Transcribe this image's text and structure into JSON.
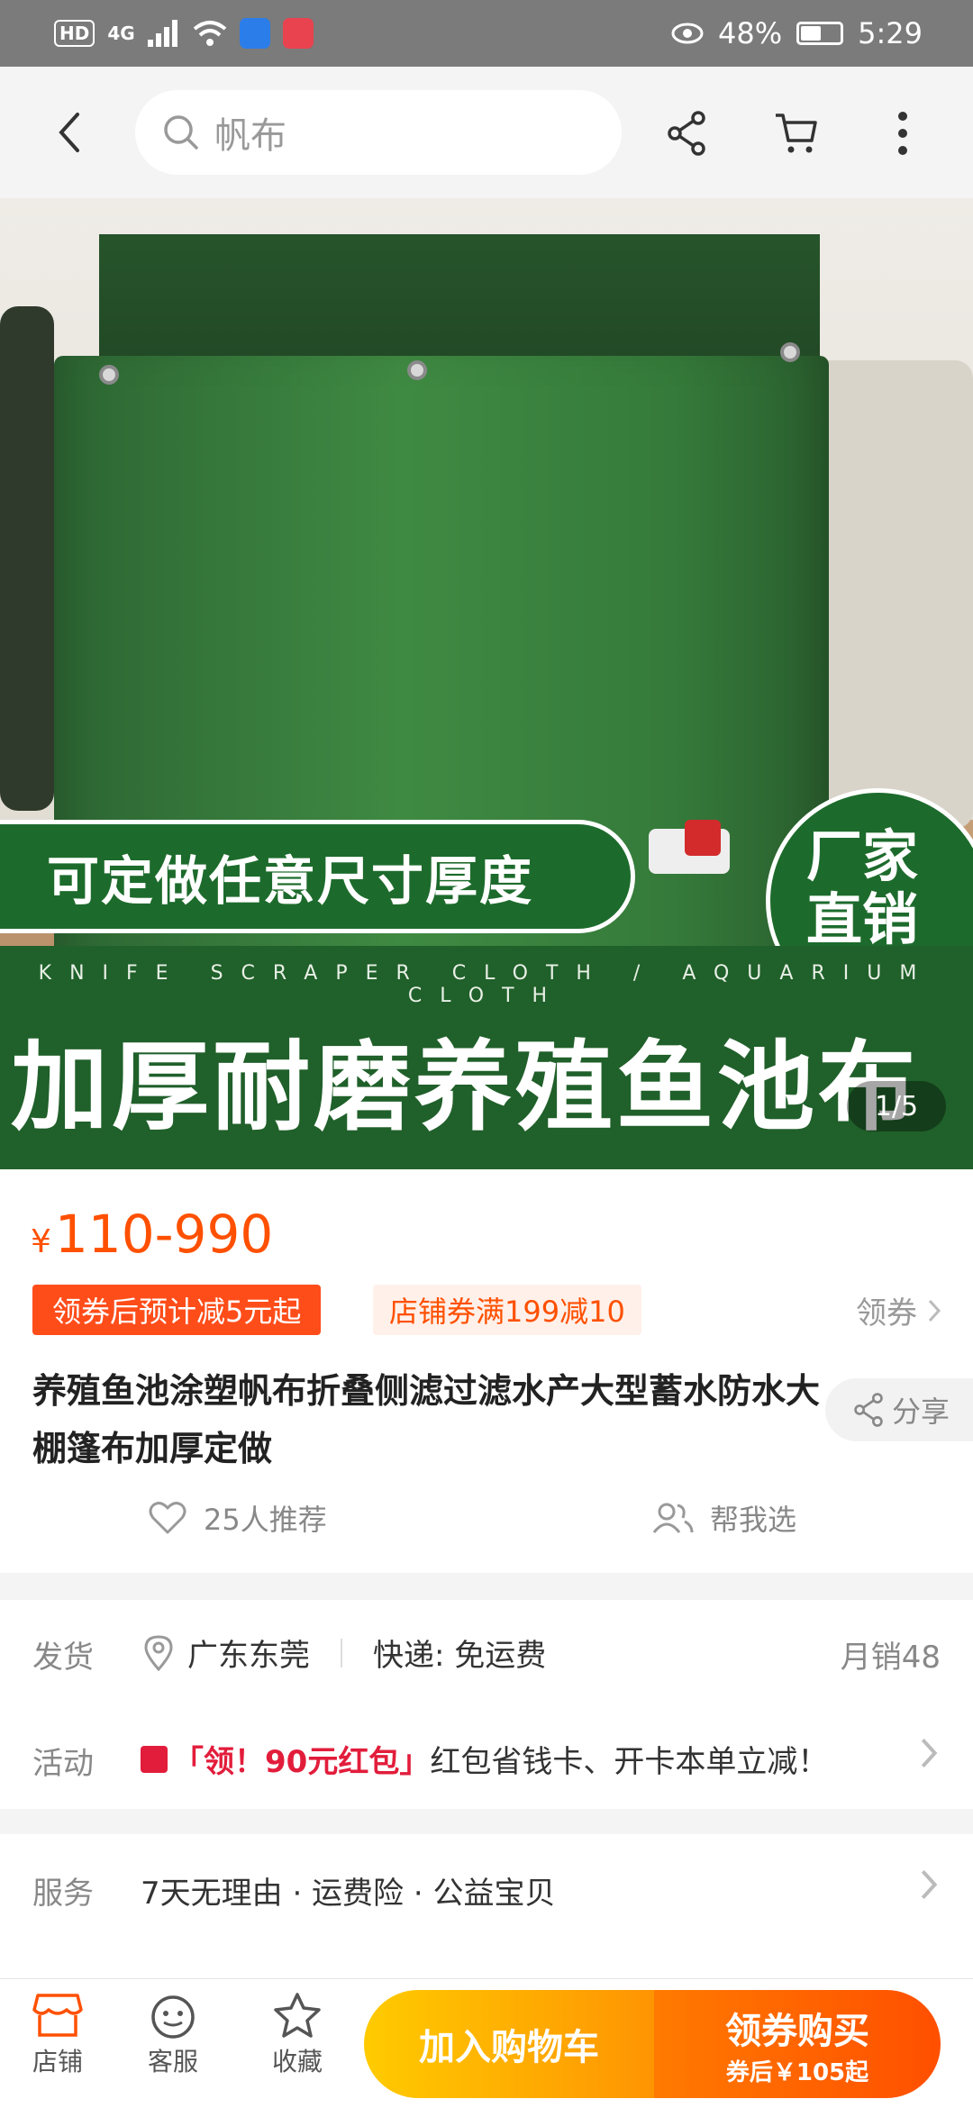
{
  "status_bar": {
    "network": "HD",
    "signal": "4G",
    "battery": "48%",
    "time": "5:29",
    "app_icon_colors": [
      "#2b7de9",
      "#e8434f"
    ]
  },
  "top_nav": {
    "search_placeholder": "帆布",
    "icons": [
      "back-icon",
      "search-icon",
      "share-icon",
      "cart-icon",
      "more-icon"
    ]
  },
  "hero": {
    "banner_text": "可定做任意尺寸厚度",
    "badge_line1": "厂家",
    "badge_line2": "直销",
    "subtitle_en": "KNIFE SCRAPER CLOTH / AQUARIUM CLOTH",
    "headline": "加厚耐磨养殖鱼池布",
    "pager": "1/5",
    "brand_green": "#1d6b2c"
  },
  "product": {
    "currency": "¥",
    "price": "110-990",
    "coupon_tag": "领券后预计减5元起",
    "shop_coupon": "店铺券满199减10",
    "get_coupon": "领券",
    "title": "养殖鱼池涂塑帆布折叠侧滤过滤水产大型蓄水防水大棚篷布加厚定做",
    "share": "分享",
    "recommend": "25人推荐",
    "help_choose": "帮我选",
    "accent_color": "#ff5000"
  },
  "shipping": {
    "label": "发货",
    "location": "广东东莞",
    "express": "快递: 免运费",
    "monthly_sales": "月销48"
  },
  "activity": {
    "label": "活动",
    "highlight": "「领！90元红包」",
    "text": "红包省钱卡、开卡本单立减！"
  },
  "service": {
    "label": "服务",
    "items": "7天无理由 · 运费险 · 公益宝贝"
  },
  "bottom_bar": {
    "shop": "店铺",
    "customer_service": "客服",
    "favorite": "收藏",
    "add_to_cart": "加入购物车",
    "buy_main": "领券购买",
    "buy_sub": "券后￥105起"
  }
}
